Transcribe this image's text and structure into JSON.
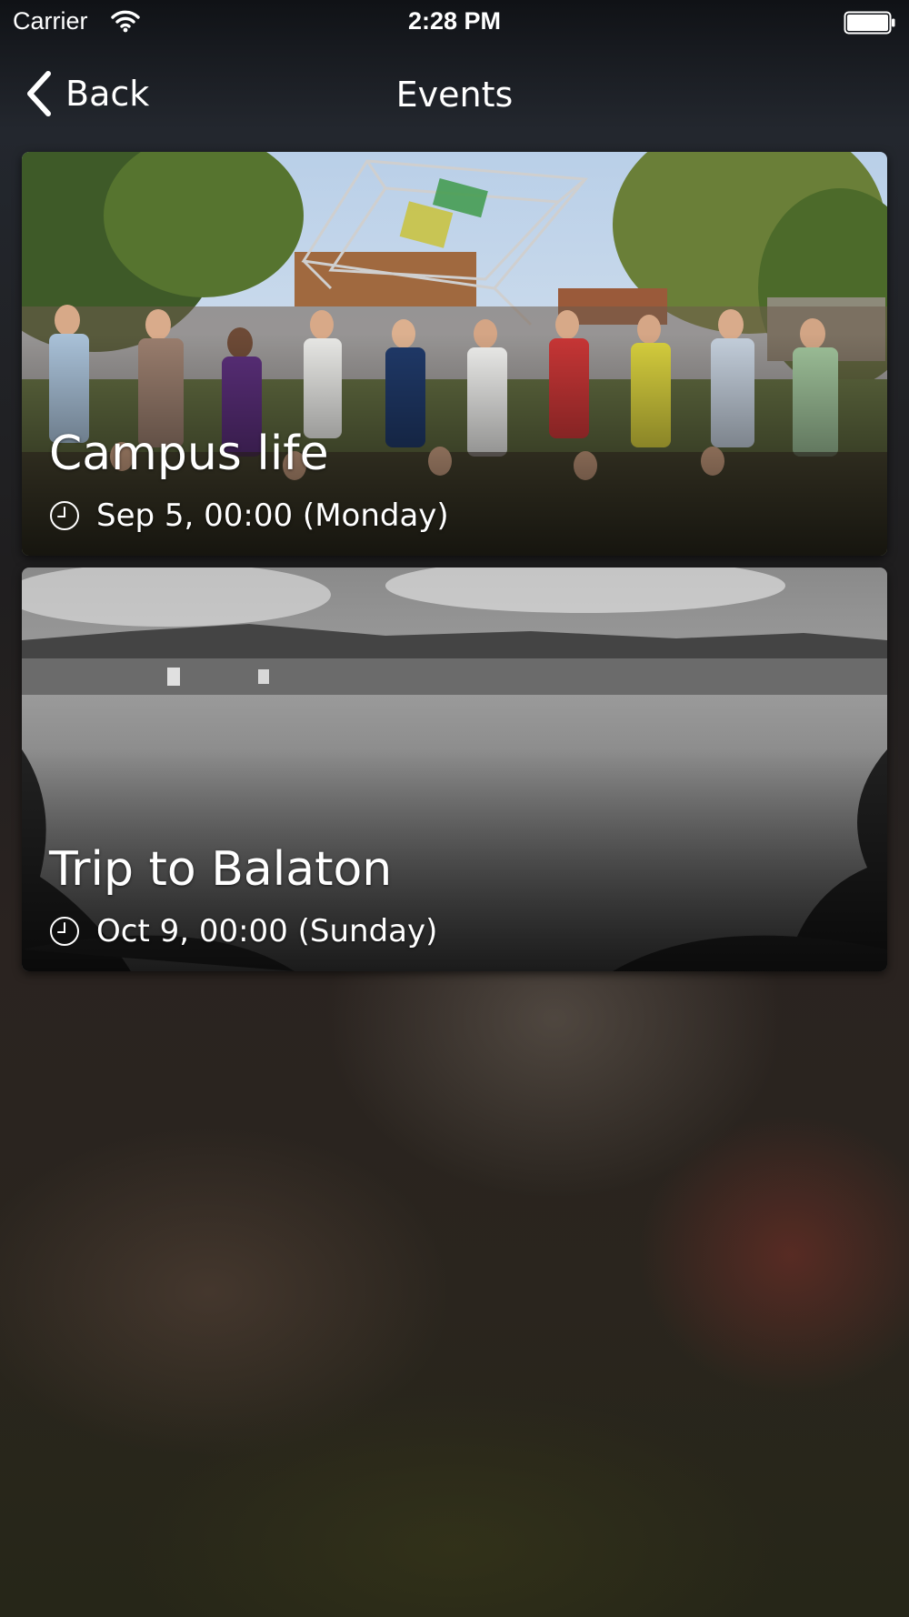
{
  "status_bar": {
    "carrier": "Carrier",
    "time": "2:28 PM",
    "icons": [
      "wifi-icon",
      "battery-icon"
    ]
  },
  "nav": {
    "back_label": "Back",
    "title": "Events",
    "back_icon": "chevron-left-icon"
  },
  "events": [
    {
      "title": "Campus life",
      "datetime": "Sep 5, 00:00 (Monday)",
      "icon": "clock-icon",
      "image": "group-photo-campus"
    },
    {
      "title": "Trip to Balaton",
      "datetime": "Oct 9, 00:00 (Sunday)",
      "icon": "clock-icon",
      "image": "lake-landscape-bw"
    }
  ],
  "colors": {
    "text": "#ffffff",
    "background_top": "#23272e",
    "background_bottom": "#262618"
  }
}
